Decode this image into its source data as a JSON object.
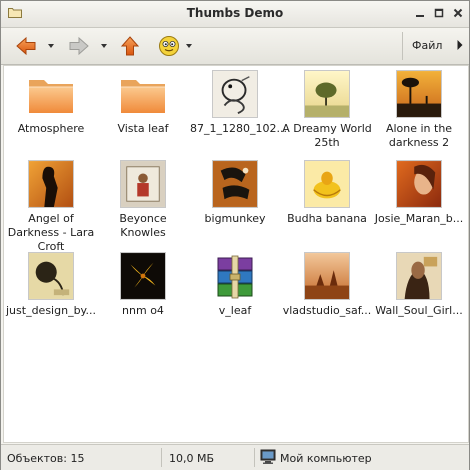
{
  "window": {
    "title": "Thumbs Demo"
  },
  "toolbar": {
    "back_icon": "arrow-left-icon",
    "forward_icon": "arrow-right-icon",
    "up_icon": "arrow-up-icon",
    "view_icon": "smiley-icon",
    "menu_label": "Файл",
    "accent": "#e8741c"
  },
  "files": [
    {
      "label": "Atmosphere",
      "kind": "folder"
    },
    {
      "label": "Vista leaf",
      "kind": "folder"
    },
    {
      "label": "87_1_1280_102...",
      "kind": "image"
    },
    {
      "label": "A Dreamy World 25th",
      "kind": "image"
    },
    {
      "label": "Alone in the darkness 2",
      "kind": "image"
    },
    {
      "label": "Angel of Darkness - Lara Croft",
      "kind": "image"
    },
    {
      "label": "Beyonce Knowles",
      "kind": "image"
    },
    {
      "label": "bigmunkey",
      "kind": "image"
    },
    {
      "label": "Budha banana",
      "kind": "image"
    },
    {
      "label": "Josie_Maran_b...",
      "kind": "image"
    },
    {
      "label": "just_design_by...",
      "kind": "image"
    },
    {
      "label": "nnm o4",
      "kind": "image"
    },
    {
      "label": "v_leaf",
      "kind": "archive"
    },
    {
      "label": "vladstudio_saf...",
      "kind": "image"
    },
    {
      "label": "Wall_Soul_Girl...",
      "kind": "image"
    }
  ],
  "status": {
    "objects": "Объектов: 15",
    "size": "10,0 МБ",
    "location": "Мой компьютер",
    "location_icon": "computer-icon"
  }
}
